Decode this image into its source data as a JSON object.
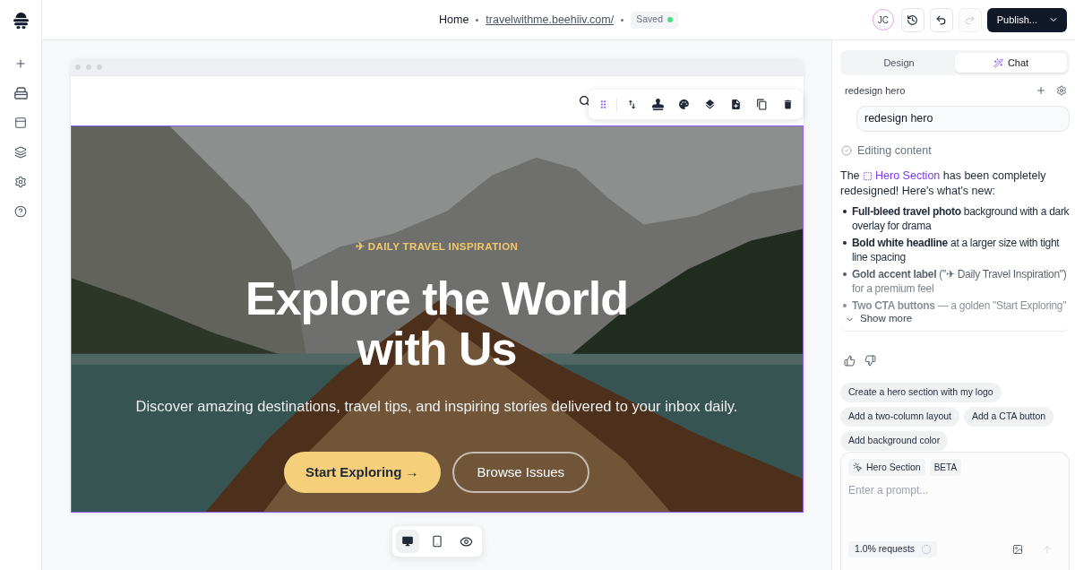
{
  "top_bar": {
    "breadcrumb": "Home",
    "url": "travelwithme.beehiiv.com/",
    "save_status": "Saved",
    "avatar_initials": "JC",
    "history_actions": [
      {
        "kind": "history",
        "disabled": false
      },
      {
        "kind": "undo",
        "disabled": false
      },
      {
        "kind": "redo",
        "disabled": true
      }
    ],
    "publish_button": "Publish..."
  },
  "canvas": {
    "hero": {
      "selected": true,
      "eyebrow": "✈ DAILY TRAVEL INSPIRATION",
      "headline": "Explore the World with Us",
      "subtitle": "Discover amazing destinations, travel tips, and inspiring stories delivered to your inbox daily.",
      "buttons": [
        {
          "label": "Start Exploring →",
          "kind": "primary"
        },
        {
          "label": "Browse Issues",
          "kind": "outline"
        }
      ]
    },
    "device_modes": [
      {
        "kind": "desktop",
        "selected": true
      },
      {
        "kind": "mobile",
        "selected": false
      },
      {
        "kind": "preview",
        "selected": false
      }
    ]
  },
  "side_panel": {
    "tabs": [
      {
        "label": "Design",
        "selected": false,
        "kind": "plain"
      },
      {
        "label": "Chat",
        "selected": true,
        "kind": "ai"
      }
    ],
    "chat": {
      "title": "redesign hero",
      "user_message": "redesign hero",
      "status": "Editing content",
      "reply": {
        "intro_before": "The",
        "link": "Hero Section",
        "intro_after": "has been completely redesigned! Here's what's new:",
        "bullets": [
          "**Full-bleed travel photo** background with a dark overlay for drama",
          "**Bold white headline** at a larger size with tight line spacing",
          "**Gold accent label** (\"✈ Daily Travel Inspiration\") for a premium feel",
          "**Two CTA buttons** — a golden \"Start Exploring\""
        ],
        "expanded": false,
        "toggle_label": "Show more"
      },
      "suggestions": [
        "Create a hero section with my logo",
        "Add a two-column layout",
        "Add a CTA button",
        "Add background color"
      ],
      "prompt": {
        "context_chip": "Hero Section",
        "badge": "BETA",
        "placeholder": "Enter a prompt...",
        "usage": {
          "label": "1.0% requests",
          "level": 0.01
        },
        "send_disabled": true
      }
    }
  }
}
